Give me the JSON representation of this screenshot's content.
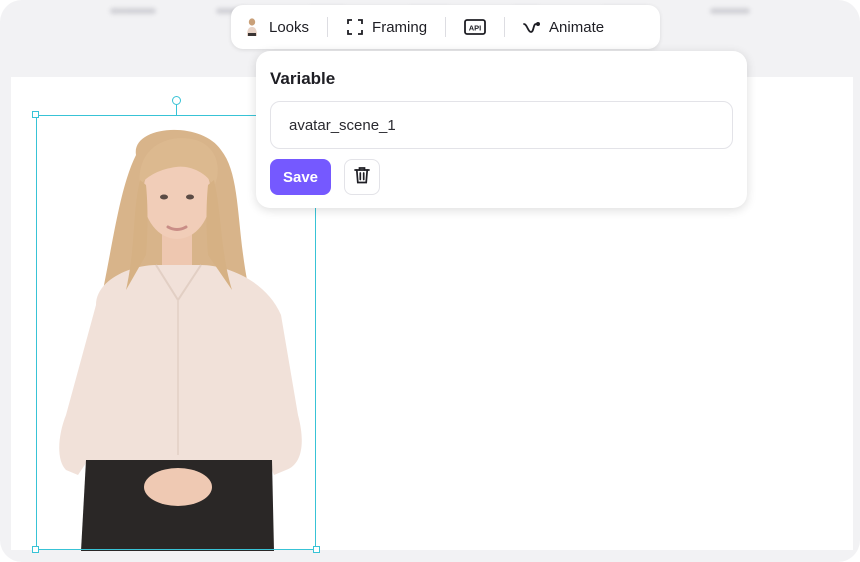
{
  "toolbar": {
    "looks_label": "Looks",
    "framing_label": "Framing",
    "api_label": "API",
    "animate_label": "Animate"
  },
  "popover": {
    "title": "Variable",
    "input_value": "avatar_scene_1",
    "save_label": "Save"
  },
  "colors": {
    "accent": "#7559ff",
    "selection": "#38c3d6"
  },
  "icons": {
    "looks": "avatar-thumbnail-icon",
    "framing": "framing-corners-icon",
    "api": "api-icon",
    "animate": "animate-curve-icon",
    "delete": "trash-icon"
  }
}
